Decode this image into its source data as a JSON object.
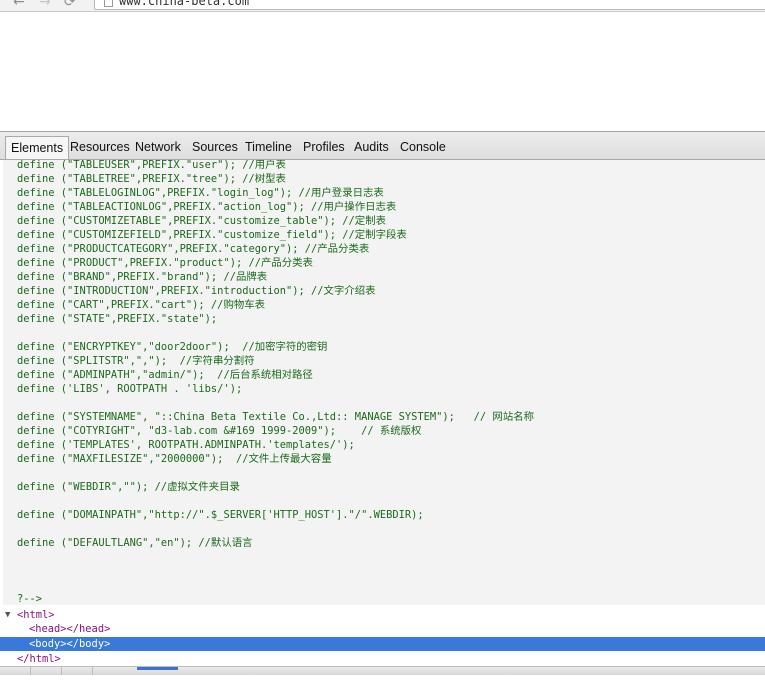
{
  "browser": {
    "url": "www.china-beta.com",
    "back_glyph": "←",
    "forward_glyph": "→",
    "reload_glyph": "⟳"
  },
  "devtools": {
    "tabs": [
      {
        "label": "Elements",
        "selected": true
      },
      {
        "label": "Resources"
      },
      {
        "label": "Network"
      },
      {
        "label": "Sources"
      },
      {
        "label": "Timeline"
      },
      {
        "label": "Profiles"
      },
      {
        "label": "Audits"
      },
      {
        "label": "Console"
      }
    ],
    "source_lines": [
      "define (\"TABLEUSER\",PREFIX.\"user\"); //用户表",
      "define (\"TABLETREE\",PREFIX.\"tree\"); //树型表",
      "define (\"TABLELOGINLOG\",PREFIX.\"login_log\"); //用户登录日志表",
      "define (\"TABLEACTIONLOG\",PREFIX.\"action_log\"); //用户操作日志表",
      "define (\"CUSTOMIZETABLE\",PREFIX.\"customize_table\"); //定制表",
      "define (\"CUSTOMIZEFIELD\",PREFIX.\"customize_field\"); //定制字段表",
      "define (\"PRODUCTCATEGORY\",PREFIX.\"category\"); //产品分类表",
      "define (\"PRODUCT\",PREFIX.\"product\"); //产品分类表",
      "define (\"BRAND\",PREFIX.\"brand\"); //品牌表",
      "define (\"INTRODUCTION\",PREFIX.\"introduction\"); //文字介绍表",
      "define (\"CART\",PREFIX.\"cart\"); //购物车表",
      "define (\"STATE\",PREFIX.\"state\");",
      "",
      "define (\"ENCRYPTKEY\",\"door2door\");  //加密字符的密钥",
      "define (\"SPLITSTR\",\",\");  //字符串分割符",
      "define (\"ADMINPATH\",\"admin/\");  //后台系统相对路径",
      "define ('LIBS', ROOTPATH . 'libs/');",
      "",
      "define (\"SYSTEMNAME\", \"::China Beta Textile Co.,Ltd:: MANAGE SYSTEM\");   // 网站名称",
      "define (\"COTYRIGHT\", \"d3-lab.com &#169 1999-2009\");    // 系统版权",
      "define ('TEMPLATES', ROOTPATH.ADMINPATH.'templates/');",
      "define (\"MAXFILESIZE\",\"2000000\");  //文件上传最大容量",
      "",
      "define (\"WEBDIR\",\"\"); //虚拟文件夹目录",
      "",
      "define (\"DOMAINPATH\",\"http://\".$_SERVER['HTTP_HOST'].\"/\".WEBDIR);",
      "",
      "define (\"DEFAULTLANG\",\"en\"); //默认语言",
      "",
      "",
      "",
      "?-->"
    ],
    "dom_lines": [
      {
        "text": "<html>",
        "indent": 0,
        "twisty": "▼"
      },
      {
        "text": "<head></head>",
        "indent": 1
      },
      {
        "text": "<body></body>",
        "indent": 1,
        "selected": true
      },
      {
        "text": "</html>",
        "indent": 0
      }
    ],
    "accent_color": "#3879d9"
  }
}
